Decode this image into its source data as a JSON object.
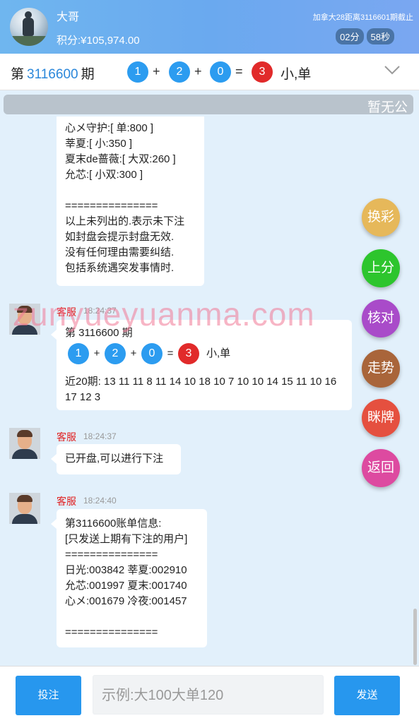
{
  "header": {
    "user_name": "大哥",
    "points": "积分:¥105,974.00",
    "countdown_title": "加拿大28距离3116601期截止",
    "timer_minutes": "02分",
    "timer_seconds": "58秒"
  },
  "draw": {
    "prefix": "第",
    "period": "3116600",
    "suffix": "期",
    "balls": [
      "1",
      "2",
      "0"
    ],
    "plus": "+",
    "equals": "=",
    "sum": "3",
    "result": "小,单"
  },
  "notice": "暂无公",
  "messages": {
    "m1": {
      "lines": [
        "心メ守护:[ 单:800 ]",
        "莘夏:[ 小:350 ]",
        "夏末de蔷薇:[ 大双:260 ]",
        "允芯:[ 小双:300 ]",
        "",
        "===============",
        "以上未列出的.表示未下注",
        "如封盘会提示封盘无效.",
        "没有任何理由需要纠结.",
        "包括系统遇突发事情时."
      ]
    },
    "m2": {
      "sender": "客服",
      "time": "18:24:37",
      "title": "第 3116600 期",
      "balls": [
        "1",
        "2",
        "0"
      ],
      "sum": "3",
      "result": "小,单",
      "recent": "近20期: 13 11 11 8 11 14 10 18 10 7 10 10 14 15 11 10 16 17 12 3"
    },
    "m3": {
      "sender": "客服",
      "time": "18:24:37",
      "text": "已开盘,可以进行下注"
    },
    "m4": {
      "sender": "客服",
      "time": "18:24:40",
      "lines": [
        "第3116600账单信息:",
        "[只发送上期有下注的用户]",
        "===============",
        "日光:003842 莘夏:002910",
        "允芯:001997 夏末:001740",
        "心メ:001679 冷夜:001457",
        "",
        "==============="
      ]
    }
  },
  "watermark": "zunyueyuanma.com",
  "fabs": {
    "switch": "换彩",
    "deposit": "上分",
    "verify": "核对",
    "trend": "走势",
    "peek": "眯牌",
    "back": "返回"
  },
  "bottom": {
    "bet_label": "投注",
    "input_placeholder": "示例:大100大单120",
    "send_label": "发送"
  },
  "colors": {
    "header_bg": "#6fb6ef",
    "ball_blue": "#2c9cf0",
    "ball_red": "#e12a2a",
    "button_blue": "#2797ee",
    "agent_name": "#e02020",
    "fab_switch": "#e6b85a",
    "fab_deposit": "#2dc52d",
    "fab_verify": "#a94bc9",
    "fab_trend": "#a9653a",
    "fab_peek": "#e5503f",
    "fab_back": "#dd4aa0"
  }
}
